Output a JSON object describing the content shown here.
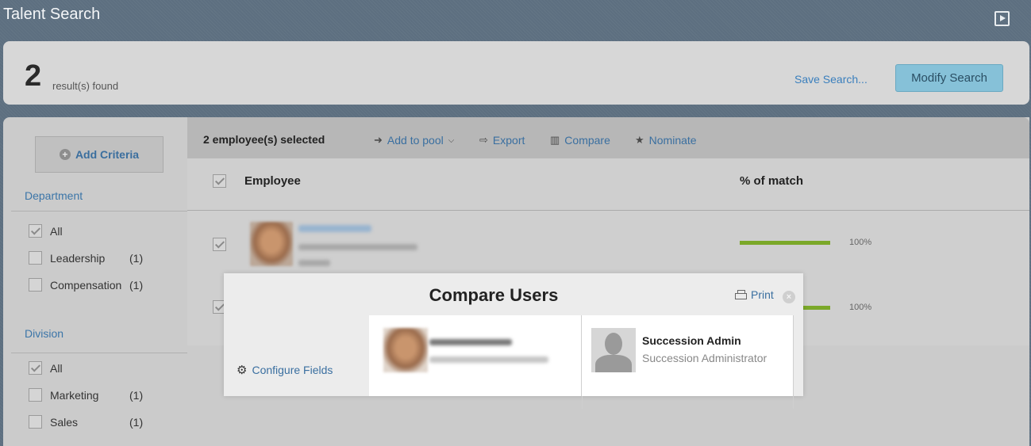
{
  "header": {
    "title": "Talent Search"
  },
  "results": {
    "count": "2",
    "label": "result(s) found",
    "save_search": "Save Search...",
    "modify_search": "Modify Search"
  },
  "sidebar": {
    "add_criteria": "Add Criteria",
    "department": {
      "title": "Department",
      "items": [
        {
          "label": "All",
          "count": "",
          "checked": true
        },
        {
          "label": "Leadership",
          "count": "(1)",
          "checked": false
        },
        {
          "label": "Compensation",
          "count": "(1)",
          "checked": false
        }
      ]
    },
    "division": {
      "title": "Division",
      "items": [
        {
          "label": "All",
          "count": "",
          "checked": true
        },
        {
          "label": "Marketing",
          "count": "(1)",
          "checked": false
        },
        {
          "label": "Sales",
          "count": "(1)",
          "checked": false
        }
      ]
    }
  },
  "toolbar": {
    "selected": "2 employee(s) selected",
    "add_to_pool": "Add to pool",
    "export": "Export",
    "compare": "Compare",
    "nominate": "Nominate"
  },
  "list": {
    "col_employee": "Employee",
    "col_match": "% of match",
    "rows": [
      {
        "match": "100%",
        "match_fraction": 1.0
      },
      {
        "match": "100%",
        "match_fraction": 1.0
      }
    ]
  },
  "modal": {
    "title": "Compare Users",
    "print": "Print",
    "configure_fields": "Configure Fields",
    "user2_name": "Succession Admin",
    "user2_title": "Succession Administrator"
  },
  "colors": {
    "accent_link": "#3a7fbd",
    "match_bar": "#7ba829",
    "modify_button": "#86c1d8"
  }
}
